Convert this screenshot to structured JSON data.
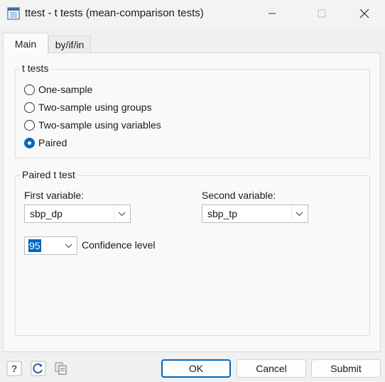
{
  "window": {
    "title": "ttest - t tests (mean-comparison tests)"
  },
  "tabs": [
    {
      "label": "Main",
      "selected": true
    },
    {
      "label": "by/if/in",
      "selected": false
    }
  ],
  "ttests_group": {
    "legend": "t tests",
    "options": [
      {
        "label": "One-sample",
        "checked": false
      },
      {
        "label": "Two-sample using groups",
        "checked": false
      },
      {
        "label": "Two-sample using variables",
        "checked": false
      },
      {
        "label": "Paired",
        "checked": true
      }
    ]
  },
  "paired_group": {
    "legend": "Paired t test",
    "first_variable": {
      "label": "First variable:",
      "value": "sbp_dp"
    },
    "second_variable": {
      "label": "Second variable:",
      "value": "sbp_tp"
    },
    "confidence": {
      "value": "95",
      "label": "Confidence level"
    }
  },
  "footer": {
    "icons": [
      "help-icon",
      "reset-icon",
      "copy-icon"
    ],
    "ok_label": "OK",
    "cancel_label": "Cancel",
    "submit_label": "Submit"
  },
  "colors": {
    "accent": "#0067c0",
    "background": "#f0f0f0",
    "panel": "#f9f9f9"
  }
}
